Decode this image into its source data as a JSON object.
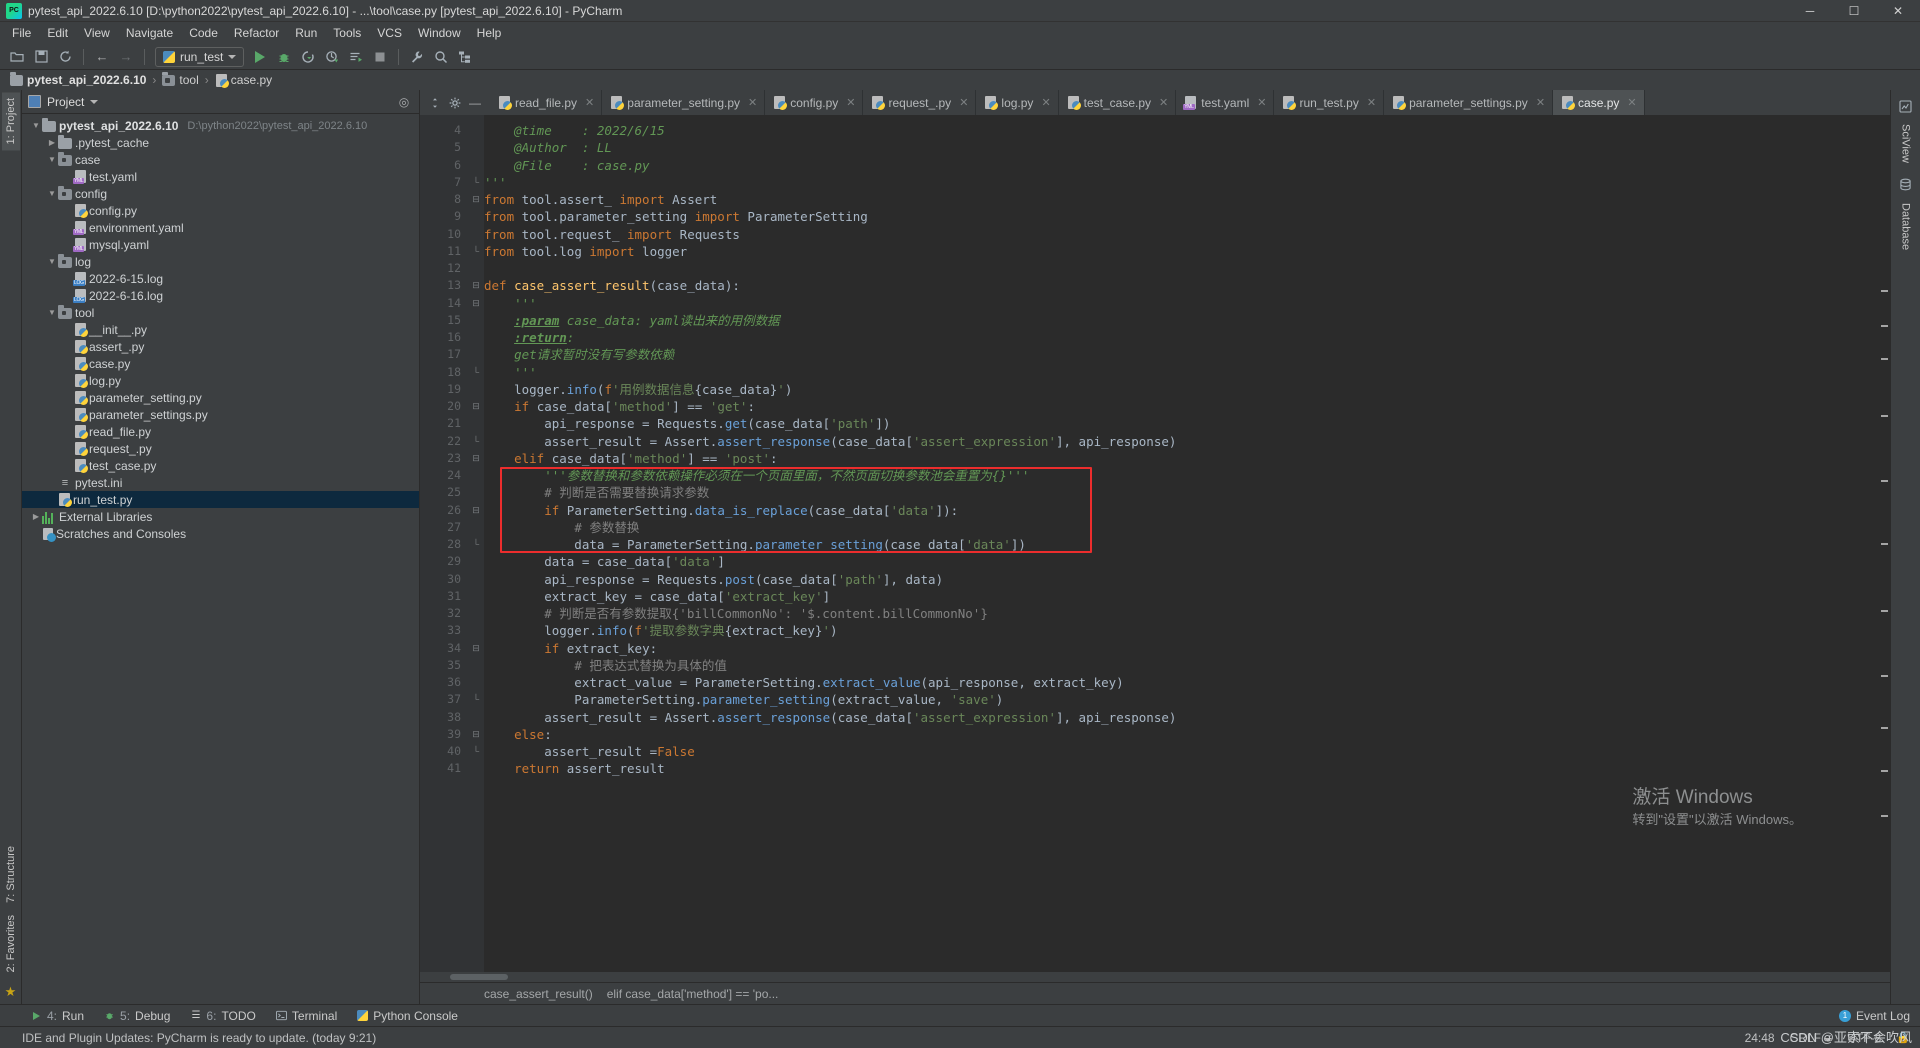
{
  "window": {
    "title": "pytest_api_2022.6.10 [D:\\python2022\\pytest_api_2022.6.10] - ...\\tool\\case.py [pytest_api_2022.6.10] - PyCharm",
    "minimize": "─",
    "maximize": "☐",
    "close": "✕"
  },
  "menu": [
    "File",
    "Edit",
    "View",
    "Navigate",
    "Code",
    "Refactor",
    "Run",
    "Tools",
    "VCS",
    "Window",
    "Help"
  ],
  "toolbar": {
    "open_icon": "open-folder-icon",
    "save_icon": "save-icon",
    "sync_icon": "sync-icon",
    "back_icon": "←",
    "forward_icon": "→",
    "run_config": "run_test",
    "run_label": "run-button",
    "debug_label": "debug-button",
    "coverage_label": "coverage-button",
    "profile_label": "profile-button",
    "more_run_label": "run-with-label",
    "stop_label": "stop-button",
    "settings_label": "settings-button",
    "search_label": "search-everywhere-button",
    "struct_label": "structure-button"
  },
  "breadcrumb": [
    {
      "label": "pytest_api_2022.6.10",
      "icon": "folder-icon",
      "bold": true
    },
    {
      "label": "tool",
      "icon": "folder-module-icon",
      "bold": false
    },
    {
      "label": "case.py",
      "icon": "python-file-icon",
      "bold": false
    }
  ],
  "left_strip": {
    "project_tab": "1: Project",
    "structure_tab": "7: Structure",
    "favorites_tab": "2: Favorites"
  },
  "right_strip": {
    "sciview_tab": "SciView",
    "database_tab": "Database"
  },
  "project": {
    "header_label": "Project",
    "header_icon": "project-view-icon",
    "caret_icon": "chevron-down-icon",
    "locate_icon": "locate-target-icon",
    "tree": [
      {
        "label": "pytest_api_2022.6.10",
        "sub": "D:\\python2022\\pytest_api_2022.6.10",
        "icon": "folder",
        "indent": 0,
        "arrow": "down",
        "bold": true
      },
      {
        "label": ".pytest_cache",
        "icon": "folder",
        "indent": 1,
        "arrow": "right",
        "bold": false
      },
      {
        "label": "case",
        "icon": "folderdot",
        "indent": 1,
        "arrow": "down",
        "bold": false
      },
      {
        "label": "test.yaml",
        "icon": "yml",
        "indent": 2,
        "arrow": "none",
        "bold": false
      },
      {
        "label": "config",
        "icon": "folderdot",
        "indent": 1,
        "arrow": "down",
        "bold": false
      },
      {
        "label": "config.py",
        "icon": "py",
        "indent": 2,
        "arrow": "none",
        "bold": false
      },
      {
        "label": "environment.yaml",
        "icon": "yml",
        "indent": 2,
        "arrow": "none",
        "bold": false
      },
      {
        "label": "mysql.yaml",
        "icon": "yml",
        "indent": 2,
        "arrow": "none",
        "bold": false
      },
      {
        "label": "log",
        "icon": "folderdot",
        "indent": 1,
        "arrow": "down",
        "bold": false
      },
      {
        "label": "2022-6-15.log",
        "icon": "logf",
        "indent": 2,
        "arrow": "none",
        "bold": false
      },
      {
        "label": "2022-6-16.log",
        "icon": "logf",
        "indent": 2,
        "arrow": "none",
        "bold": false
      },
      {
        "label": "tool",
        "icon": "folderdot",
        "indent": 1,
        "arrow": "down",
        "bold": false
      },
      {
        "label": "__init__.py",
        "icon": "py",
        "indent": 2,
        "arrow": "none",
        "bold": false
      },
      {
        "label": "assert_.py",
        "icon": "py",
        "indent": 2,
        "arrow": "none",
        "bold": false
      },
      {
        "label": "case.py",
        "icon": "py",
        "indent": 2,
        "arrow": "none",
        "bold": false
      },
      {
        "label": "log.py",
        "icon": "py",
        "indent": 2,
        "arrow": "none",
        "bold": false
      },
      {
        "label": "parameter_setting.py",
        "icon": "py",
        "indent": 2,
        "arrow": "none",
        "bold": false
      },
      {
        "label": "parameter_settings.py",
        "icon": "py",
        "indent": 2,
        "arrow": "none",
        "bold": false
      },
      {
        "label": "read_file.py",
        "icon": "py",
        "indent": 2,
        "arrow": "none",
        "bold": false
      },
      {
        "label": "request_.py",
        "icon": "py",
        "indent": 2,
        "arrow": "none",
        "bold": false
      },
      {
        "label": "test_case.py",
        "icon": "py",
        "indent": 2,
        "arrow": "none",
        "bold": false
      },
      {
        "label": "pytest.ini",
        "icon": "ini",
        "indent": 1,
        "arrow": "none",
        "bold": false
      },
      {
        "label": "run_test.py",
        "icon": "py",
        "indent": 1,
        "arrow": "none",
        "bold": false,
        "selected": true
      },
      {
        "label": "External Libraries",
        "icon": "lib",
        "indent": 0,
        "arrow": "right",
        "bold": false
      },
      {
        "label": "Scratches and Consoles",
        "icon": "scratch",
        "indent": 0,
        "arrow": "none",
        "bold": false
      }
    ]
  },
  "editor_tabs": [
    {
      "label": "read_file.py",
      "icon": "python-file-icon",
      "active": false
    },
    {
      "label": "parameter_setting.py",
      "icon": "python-file-icon",
      "active": false
    },
    {
      "label": "config.py",
      "icon": "python-file-icon",
      "active": false
    },
    {
      "label": "request_.py",
      "icon": "python-file-icon",
      "active": false
    },
    {
      "label": "log.py",
      "icon": "python-file-icon",
      "active": false
    },
    {
      "label": "test_case.py",
      "icon": "python-file-icon",
      "active": false
    },
    {
      "label": "test.yaml",
      "icon": "yaml-file-icon",
      "active": false
    },
    {
      "label": "run_test.py",
      "icon": "python-file-icon",
      "active": false
    },
    {
      "label": "parameter_settings.py",
      "icon": "python-file-icon",
      "active": false
    },
    {
      "label": "case.py",
      "icon": "python-file-icon",
      "active": true
    }
  ],
  "editor": {
    "first_line": 4,
    "lines": [
      {
        "n": 4,
        "fold": "",
        "html": "    <span class='doc'>@time    : 2022/6/15</span>"
      },
      {
        "n": 5,
        "fold": "",
        "html": "    <span class='doc'>@Author  : LL</span>"
      },
      {
        "n": 6,
        "fold": "",
        "html": "    <span class='doc'>@File    : case.py</span>"
      },
      {
        "n": 7,
        "fold": "end",
        "html": "<span class='doc'>'''</span>"
      },
      {
        "n": 8,
        "fold": "start",
        "html": "<span class='kw'>from</span> tool.assert_ <span class='kw'>import</span> Assert"
      },
      {
        "n": 9,
        "fold": "",
        "html": "<span class='kw'>from</span> tool.parameter_setting <span class='kw'>import</span> ParameterSetting"
      },
      {
        "n": 10,
        "fold": "",
        "html": "<span class='kw'>from</span> tool.request_ <span class='kw'>import</span> Requests"
      },
      {
        "n": 11,
        "fold": "end",
        "html": "<span class='kw'>from</span> tool.log <span class='kw'>import</span> logger"
      },
      {
        "n": 12,
        "fold": "",
        "html": ""
      },
      {
        "n": 13,
        "fold": "start",
        "html": "<span class='kw'>def</span> <span class='fn'>case_assert_result</span>(case_data):"
      },
      {
        "n": 14,
        "fold": "start",
        "html": "    <span class='doc'>'''</span>"
      },
      {
        "n": 15,
        "fold": "",
        "html": "    <span class='doctag'>:param</span> <span class='doc'>case_data: yaml读出来的用例数据</span>"
      },
      {
        "n": 16,
        "fold": "",
        "html": "    <span class='doctag'>:return</span><span class='doc'>:</span>"
      },
      {
        "n": 17,
        "fold": "",
        "html": "    <span class='doc'>get请求暂时没有写参数依赖</span>"
      },
      {
        "n": 18,
        "fold": "end",
        "html": "    <span class='doc'>'''</span>"
      },
      {
        "n": 19,
        "fold": "",
        "html": "    logger.<span class='methc'>info</span>(<span class='kw'>f</span><span class='str'>'用例数据信息</span>{case_data}<span class='str'>'</span>)"
      },
      {
        "n": 20,
        "fold": "start",
        "html": "    <span class='kw'>if</span> case_data[<span class='str'>'method'</span>] == <span class='str'>'get'</span>:"
      },
      {
        "n": 21,
        "fold": "",
        "html": "        api_response = Requests.<span class='methc'>get</span>(case_data[<span class='str'>'path'</span>])"
      },
      {
        "n": 22,
        "fold": "end",
        "html": "        assert_result = Assert.<span class='methc'>assert_response</span>(case_data[<span class='str'>'assert_expression'</span>], api_response)"
      },
      {
        "n": 23,
        "fold": "start",
        "html": "    <span class='kw'>elif</span> case_data[<span class='str'>'method'</span>] == <span class='str'>'post'</span>:"
      },
      {
        "n": 24,
        "fold": "",
        "html": "        <span class='doc'>'''参数替换和参数依赖操作必须在一个页面里面，不然页面切换参数池会重置为{}'''</span>"
      },
      {
        "n": 25,
        "fold": "",
        "html": "        <span class='cm'># 判断是否需要替换请求参数</span>"
      },
      {
        "n": 26,
        "fold": "start",
        "html": "        <span class='kw'>if</span> ParameterSetting.<span class='methc'>data_is_replace</span>(case_data[<span class='str'>'data'</span>]):"
      },
      {
        "n": 27,
        "fold": "",
        "html": "            <span class='cm'># 参数替换</span>"
      },
      {
        "n": 28,
        "fold": "end",
        "html": "            data = ParameterSetting.<span class='methc'>parameter_setting</span>(case_data[<span class='str'>'data'</span>])"
      },
      {
        "n": 29,
        "fold": "",
        "html": "        data = case_data[<span class='str'>'data'</span>]"
      },
      {
        "n": 30,
        "fold": "",
        "html": "        api_response = Requests.<span class='methc'>post</span>(case_data[<span class='str'>'path'</span>], data)"
      },
      {
        "n": 31,
        "fold": "",
        "html": "        extract_key = case_data[<span class='str'>'extract_key'</span>]"
      },
      {
        "n": 32,
        "fold": "",
        "html": "        <span class='cm'># 判断是否有参数提取{'billCommonNo': '$.content.billCommonNo'}</span>"
      },
      {
        "n": 33,
        "fold": "",
        "html": "        logger.<span class='methc'>info</span>(<span class='kw'>f</span><span class='str'>'提取参数字典</span>{extract_key}<span class='str'>'</span>)"
      },
      {
        "n": 34,
        "fold": "start",
        "html": "        <span class='kw'>if</span> extract_key:"
      },
      {
        "n": 35,
        "fold": "",
        "html": "            <span class='cm'># 把表达式替换为具体的值</span>"
      },
      {
        "n": 36,
        "fold": "",
        "html": "            extract_value = ParameterSetting.<span class='methc'>extract_value</span>(api_response, extract_key)"
      },
      {
        "n": 37,
        "fold": "end",
        "html": "            ParameterSetting.<span class='methc'>parameter_setting</span>(extract_value, <span class='str'>'save'</span>)"
      },
      {
        "n": 38,
        "fold": "",
        "html": "        assert_result = Assert.<span class='methc'>assert_response</span>(case_data[<span class='str'>'assert_expression'</span>], api_response)"
      },
      {
        "n": 39,
        "fold": "start",
        "html": "    <span class='kw'>else</span>:"
      },
      {
        "n": 40,
        "fold": "end",
        "html": "        assert_result =<span class='kw'>False</span>"
      },
      {
        "n": 41,
        "fold": "",
        "html": "    <span class='kw'>return</span> assert_result"
      }
    ],
    "highlight_box": {
      "from_line": 24,
      "to_line": 28,
      "color": "#ec2d2d"
    }
  },
  "editor_footer": {
    "breadcrumb_fn": "case_assert_result()",
    "breadcrumb_stmt": "elif case_data['method'] == 'po..."
  },
  "tool_windows": [
    {
      "num": "4:",
      "label": "Run",
      "icon": "run-icon"
    },
    {
      "num": "5:",
      "label": "Debug",
      "icon": "debug-icon"
    },
    {
      "num": "6:",
      "label": "TODO",
      "icon": "todo-icon"
    },
    {
      "num": "",
      "label": "Terminal",
      "icon": "terminal-icon"
    },
    {
      "num": "",
      "label": "Python Console",
      "icon": "python-console-icon"
    }
  ],
  "event_log": {
    "label": "Event Log",
    "count": "1"
  },
  "status": {
    "message": "IDE and Plugin Updates: PyCharm is ready to update. (today 9:21)",
    "caret": "24:48",
    "line_sep": "CRLF",
    "encoding": "UTF-8",
    "indent": "4 spaces",
    "lock_icon": "lock-icon"
  },
  "watermark": {
    "line1": "激活 Windows",
    "line2": "转到\"设置\"以激活 Windows。"
  },
  "csdn": "CSDN @亚索不会吹风",
  "colors": {
    "accent": "#4b6eaf",
    "editor_bg": "#2b2b2b",
    "panel_bg": "#3c3f41",
    "highlight_red": "#ec2d2d",
    "selection_blue": "#0d293e",
    "keyword_orange": "#cc7832",
    "string_green": "#6a8759",
    "comment_gray": "#808080",
    "doc_green": "#629755"
  }
}
